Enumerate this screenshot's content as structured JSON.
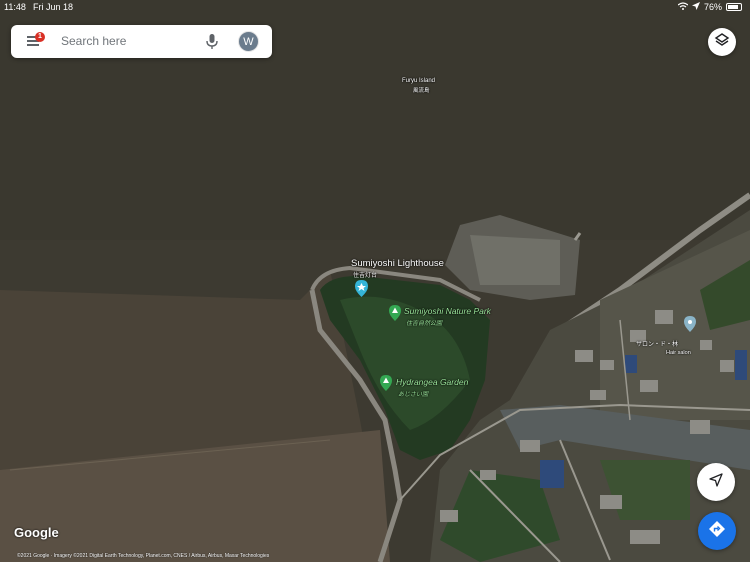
{
  "status_bar": {
    "time": "11:48",
    "date": "Fri Jun 18",
    "battery": "76%"
  },
  "search": {
    "placeholder": "Search here",
    "notification_count": "1",
    "avatar_letter": "W"
  },
  "map_labels": {
    "furyu_island": "Furyu Island",
    "furyu_island_jp": "風流島",
    "lighthouse": "Sumiyoshi Lighthouse",
    "lighthouse_jp": "住吉灯台",
    "nature_park": "Sumiyoshi Nature Park",
    "nature_park_jp": "住吉自然公園",
    "hydrangea": "Hydrangea Garden",
    "hydrangea_jp": "あじさい園",
    "salon": "サロン・ド・林",
    "salon_sub": "Hair salon"
  },
  "footer": {
    "logo": "Google",
    "attribution": "©2021 Google · Imagery ©2021 Digital Earth Technology, Planet.com, CNES / Airbus, Airbus, Maxar Technologies"
  },
  "icons": {
    "menu": "menu-icon",
    "mic": "mic-icon",
    "layers": "layers-icon",
    "location": "location-arrow-icon",
    "directions": "directions-icon"
  }
}
